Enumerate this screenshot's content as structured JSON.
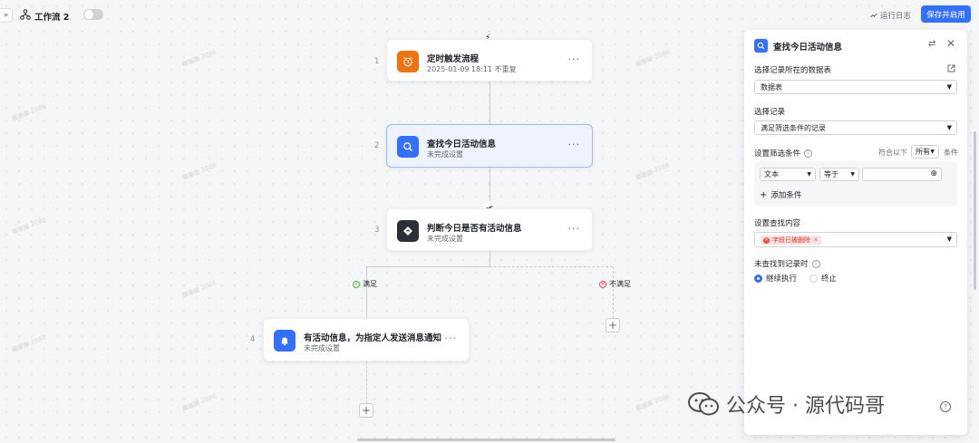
{
  "header": {
    "workflow_title": "工作流 2",
    "expand_glyph": "»",
    "run_log_label": "运行日志",
    "save_enable_label": "保存并启用"
  },
  "nodes": [
    {
      "num": "1",
      "title": "定时触发流程",
      "subtitle": "2025-01-09 18:11 不重复",
      "icon": "alarm-clock-icon",
      "color": "#f2720c"
    },
    {
      "num": "2",
      "title": "查找今日活动信息",
      "subtitle": "未完成设置",
      "icon": "search-icon",
      "color": "#3370ff"
    },
    {
      "num": "3",
      "title": "判断今日是否有活动信息",
      "subtitle": "未完成设置",
      "icon": "branch-diamond-icon",
      "color": "#2b2f36"
    },
    {
      "num": "4",
      "title": "有活动信息，为指定人发送消息通知",
      "subtitle": "未完成设置",
      "icon": "bell-icon",
      "color": "#3370ff"
    }
  ],
  "node_more": "···",
  "branches": {
    "yes_label": "满足",
    "no_label": "不满足"
  },
  "panel": {
    "title": "查找今日活动信息",
    "table_label": "选择记录所在的数据表",
    "table_value": "数据表",
    "record_label": "选择记录",
    "record_value": "满足筛选条件的记录",
    "filter_label": "设置筛选条件",
    "match_prefix": "符合以下",
    "match_value": "所有",
    "match_suffix": "条件",
    "cond_field": "文本",
    "cond_op": "等于",
    "add_condition": "添加条件",
    "content_label": "设置查找内容",
    "deleted_tag": "字段已被删除",
    "not_found_label": "未查找到记录时",
    "option_continue": "继续执行",
    "option_stop": "终止"
  },
  "brand": {
    "text": "公众号 · 源代码哥"
  },
  "colors": {
    "accent": "#3370ff",
    "trigger": "#f2720c",
    "error": "#f54a45",
    "success": "#34c724"
  }
}
